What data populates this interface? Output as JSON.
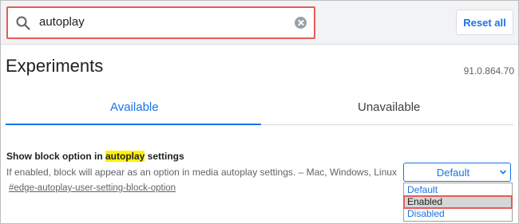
{
  "search": {
    "value": "autoplay"
  },
  "toolbar": {
    "reset_label": "Reset all"
  },
  "page": {
    "title": "Experiments",
    "version": "91.0.864.70"
  },
  "tabs": [
    {
      "label": "Available",
      "active": true
    },
    {
      "label": "Unavailable",
      "active": false
    }
  ],
  "flag": {
    "title_before": "Show block option in ",
    "title_highlight": "autoplay",
    "title_after": " settings",
    "description": "If enabled, block will appear as an option in media autoplay settings. – Mac, Windows, Linux",
    "link": "#edge-autoplay-user-setting-block-option",
    "select_value": "Default",
    "options": [
      "Default",
      "Enabled",
      "Disabled"
    ],
    "highlighted_option": "Enabled"
  },
  "colors": {
    "accent": "#1a73e8",
    "search_highlight_border": "#e35d5b",
    "text_highlight": "#fff200"
  },
  "icons": {
    "search": "search-icon",
    "clear": "clear-icon",
    "dropdown": "chevron-down-icon"
  }
}
